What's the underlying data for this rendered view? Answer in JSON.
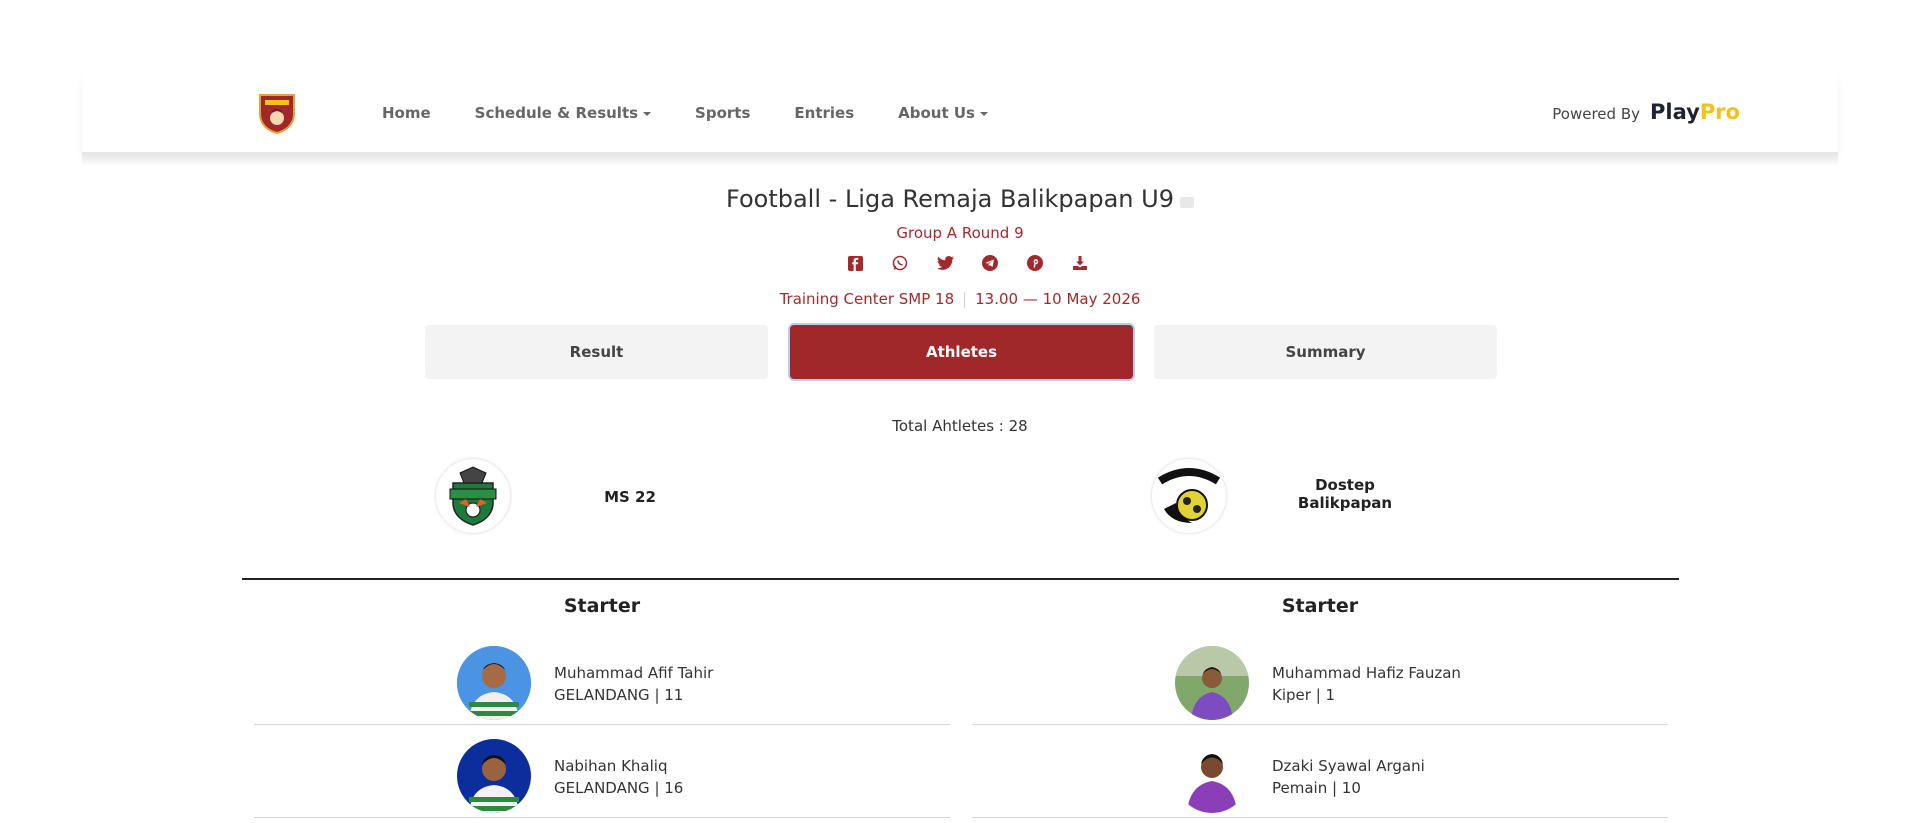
{
  "nav": {
    "items": [
      {
        "label": "Home",
        "dropdown": false
      },
      {
        "label": "Schedule & Results",
        "dropdown": true
      },
      {
        "label": "Sports",
        "dropdown": false
      },
      {
        "label": "Entries",
        "dropdown": false
      },
      {
        "label": "About Us",
        "dropdown": true
      }
    ],
    "powered_by": "Powered By",
    "brand_play": "Play",
    "brand_pro": "Pro"
  },
  "event": {
    "title": "Football - Liga Remaja Balikpapan U9",
    "round": "Group A Round 9",
    "venue": "Training Center SMP 18",
    "datetime": "13.00 — 10 May 2026"
  },
  "share_icons": [
    "facebook-icon",
    "whatsapp-icon",
    "twitter-icon",
    "telegram-icon",
    "pinterest-icon",
    "download-icon"
  ],
  "tabs": {
    "result": "Result",
    "athletes": "Athletes",
    "summary": "Summary"
  },
  "total_athletes": "Total Ahtletes : 28",
  "teams": {
    "home": {
      "name": "MS 22"
    },
    "away": {
      "name_line1": "Dostep",
      "name_line2": "Balikpapan"
    }
  },
  "lineup": {
    "home_title": "Starter",
    "away_title": "Starter",
    "home_players": [
      {
        "name": "Muhammad Afif Tahir",
        "role": "GELANDANG | 11"
      },
      {
        "name": "Nabihan Khaliq",
        "role": "GELANDANG | 16"
      }
    ],
    "away_players": [
      {
        "name": "Muhammad Hafiz Fauzan",
        "role": "Kiper | 1"
      },
      {
        "name": "Dzaki Syawal Argani",
        "role": "Pemain | 10"
      }
    ]
  },
  "colors": {
    "accent": "#a0282b",
    "brand_dark": "#1f2233",
    "brand_yellow": "#f2c21b"
  }
}
